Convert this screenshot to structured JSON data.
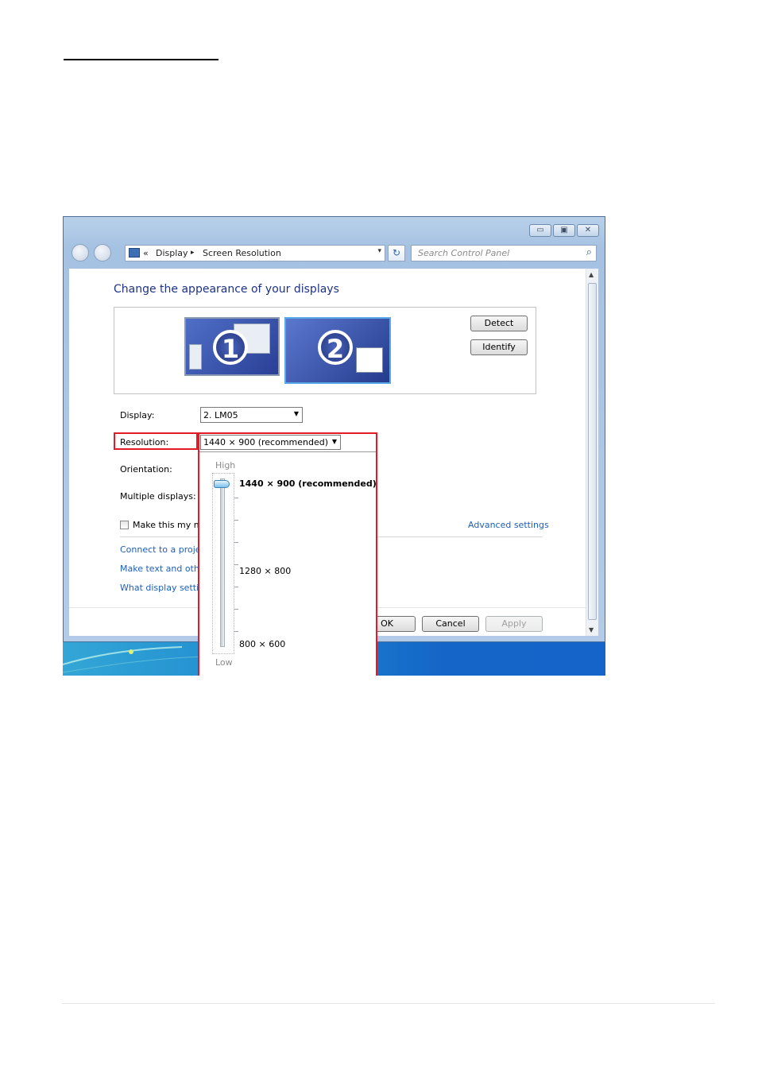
{
  "address_bar": {
    "overflow": "«",
    "crumb1": "Display",
    "separator": "▸",
    "crumb2": "Screen Resolution",
    "dropdown": "▾"
  },
  "refresh_icon": "↻",
  "search": {
    "placeholder": "Search Control Panel",
    "icon": "search-icon"
  },
  "caption_buttons": {
    "minimize": "▭",
    "maximize": "▣",
    "close": "✕"
  },
  "main": {
    "heading": "Change the appearance of your displays",
    "monitors": [
      {
        "number": "1"
      },
      {
        "number": "2"
      }
    ],
    "detect_label": "Detect",
    "identify_label": "Identify",
    "display_label": "Display:",
    "display_value": "2. LM05",
    "resolution_label": "Resolution:",
    "resolution_value": "1440 × 900 (recommended)",
    "orientation_label": "Orientation:",
    "multiple_displays_label": "Multiple displays:",
    "make_main_label": "Make this my m",
    "advanced_link": "Advanced settings",
    "links": [
      "Connect to a projec",
      "Make text and othe",
      "What display settin"
    ],
    "ok_label": "OK",
    "cancel_label": "Cancel",
    "apply_label": "Apply"
  },
  "resolution_dropdown": {
    "high_label": "High",
    "low_label": "Low",
    "options": [
      "1440 × 900 (recommended)",
      "1280 × 800",
      "800 × 600"
    ],
    "selected": "1440 × 900 (recommended)",
    "slider_level": 1.0
  },
  "colors": {
    "highlight": "#e21b26",
    "link": "#1c5fb8",
    "heading": "#1e3287",
    "taskbar": "#1d88cf"
  }
}
